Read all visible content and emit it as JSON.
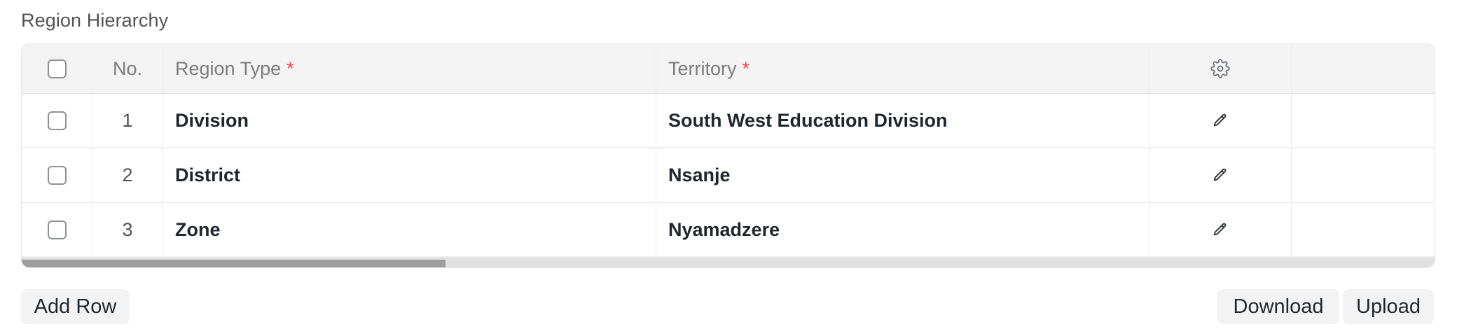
{
  "section": {
    "title": "Region Hierarchy"
  },
  "table": {
    "columns": {
      "no": "No.",
      "region_type": "Region Type",
      "territory": "Territory",
      "required_marker": "*"
    },
    "rows": [
      {
        "no": "1",
        "region_type": "Division",
        "territory": "South West Education Division"
      },
      {
        "no": "2",
        "region_type": "District",
        "territory": "Nsanje"
      },
      {
        "no": "3",
        "region_type": "Zone",
        "territory": "Nyamadzere"
      }
    ],
    "settings_icon": "gear-icon",
    "edit_icon": "pencil-icon",
    "scroll_position": 0.3
  },
  "actions": {
    "add_row": "Add Row",
    "download": "Download",
    "upload": "Upload"
  },
  "colors": {
    "required": "#e24c4c",
    "header_bg": "#f3f3f3",
    "button_bg": "#f3f3f3"
  }
}
